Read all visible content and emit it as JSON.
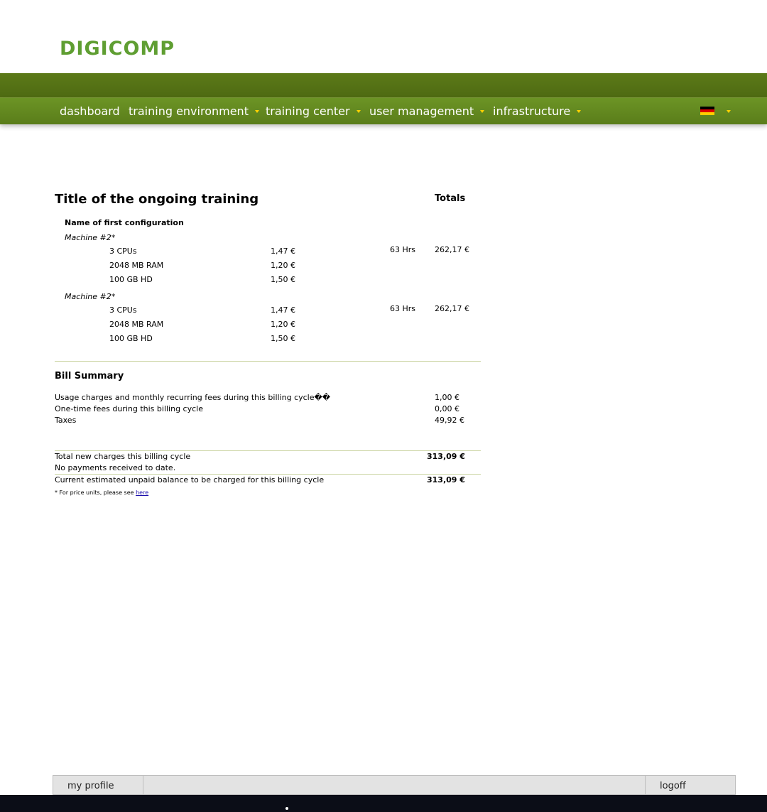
{
  "header": {
    "logo_text": "DIGICOMP"
  },
  "nav": {
    "items": [
      {
        "label": "dashboard",
        "has_dropdown": false
      },
      {
        "label": "training environment",
        "has_dropdown": true
      },
      {
        "label": "training center",
        "has_dropdown": true
      },
      {
        "label": "user management",
        "has_dropdown": true
      },
      {
        "label": "infrastructure",
        "has_dropdown": true
      }
    ],
    "language_flag": "german-flag-icon"
  },
  "bill": {
    "title": "Title of the ongoing training",
    "totals_label": "Totals",
    "configuration_name": "Name of first configuration",
    "machines": [
      {
        "name": "Machine #2*",
        "hours": "63 Hrs",
        "total": "262,17 €",
        "resources": [
          {
            "label": "3 CPUs",
            "price": "1,47 €"
          },
          {
            "label": "2048 MB RAM",
            "price": "1,20 €"
          },
          {
            "label": "100 GB HD",
            "price": "1,50 €"
          }
        ]
      },
      {
        "name": "Machine #2*",
        "hours": "63 Hrs",
        "total": "262,17 €",
        "resources": [
          {
            "label": "3 CPUs",
            "price": "1,47 €"
          },
          {
            "label": "2048 MB RAM",
            "price": "1,20 €"
          },
          {
            "label": "100 GB HD",
            "price": "1,50 €"
          }
        ]
      }
    ]
  },
  "summary": {
    "heading": "Bill Summary",
    "lines": [
      {
        "label": "Usage charges and monthly recurring fees during this billing cycle��",
        "amount": "1,00 €"
      },
      {
        "label": "One-time fees during this billing cycle",
        "amount": "0,00 €"
      },
      {
        "label": "Taxes",
        "amount": "49,92 €"
      }
    ],
    "total_label": "Total new charges this billing cycle",
    "total_amount": "313,09 €",
    "payments_text": "No payments received to date.",
    "balance_label": "Current estimated unpaid balance to be charged for this billing cycle",
    "balance_amount": "313,09 €",
    "note_text": "* For price units, please see",
    "note_link": "here"
  },
  "footer": {
    "my_profile": "my profile",
    "logoff": "logoff"
  },
  "colors": {
    "brand_green": "#5f9e32",
    "nav_green": "#6c9425",
    "topbar_green": "#5c7a18",
    "caret_yellow": "#ffd200"
  }
}
